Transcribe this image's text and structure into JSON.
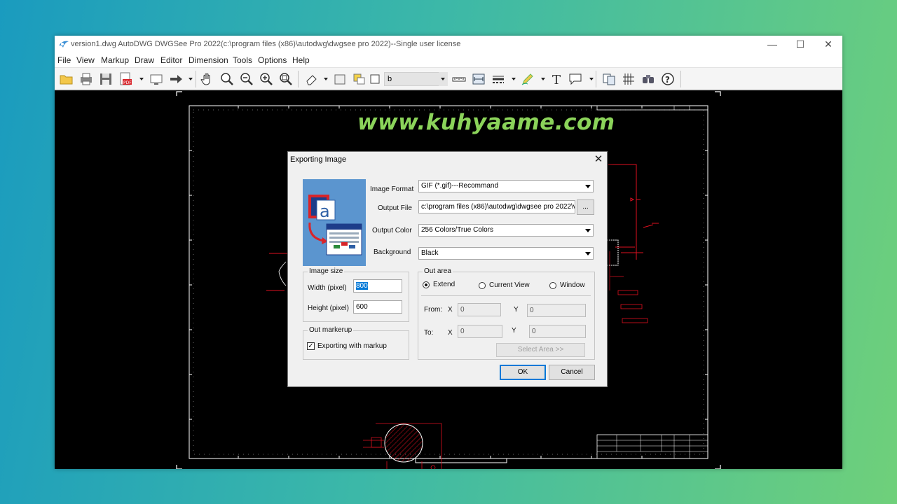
{
  "window": {
    "title": "version1.dwg AutoDWG DWGSee Pro 2022(c:\\program files (x86)\\autodwg\\dwgsee pro 2022)--Single user license",
    "minimize_glyph": "—",
    "maximize_glyph": "☐",
    "close_glyph": "✕"
  },
  "menu": [
    "File",
    "View",
    "Markup",
    "Draw",
    "Editor",
    "Dimension",
    "Tools",
    "Options",
    "Help"
  ],
  "toolbar": {
    "layer_value": "b",
    "icons": [
      "open-folder-icon",
      "print-icon",
      "save-icon",
      "export-pdf-icon",
      "screen-icon",
      "arrow-right-icon",
      "pan-hand-icon",
      "zoom-window-icon",
      "zoom-out-icon",
      "zoom-in-icon",
      "zoom-extents-icon",
      "eraser-icon",
      "layer-rect-icon",
      "layer-color-icon",
      "layer-square-icon",
      "measure-icon",
      "dimension-icon",
      "linetype-icon",
      "pen-icon",
      "text-icon",
      "comment-icon",
      "compare-icon",
      "hatch-icon",
      "find-icon",
      "help-icon"
    ]
  },
  "watermark": "www.kuhyaame.com",
  "dialog": {
    "title": "Exporting Image",
    "close_glyph": "✕",
    "image_format_label": "Image Format",
    "image_format_value": "GIF (*.gif)---Recommand",
    "output_file_label": "Output File",
    "output_file_value": "c:\\program files (x86)\\autodwg\\dwgsee pro 2022\\v",
    "browse_label": "...",
    "output_color_label": "Output Color",
    "output_color_value": "256 Colors/True Colors",
    "background_label": "Background",
    "background_value": "Black",
    "image_size": {
      "title": "Image size",
      "width_label": "Width (pixel)",
      "width_value": "800",
      "height_label": "Height (pixel)",
      "height_value": "600"
    },
    "out_markerup": {
      "title": "Out markerup",
      "checkbox_label": "Exporting with markup",
      "checked": true
    },
    "out_area": {
      "title": "Out area",
      "options": [
        "Extend",
        "Current View",
        "Window"
      ],
      "selected": "Extend",
      "from_label": "From:",
      "to_label": "To:",
      "x_label": "X",
      "y_label": "Y",
      "from_x": "0",
      "from_y": "0",
      "to_x": "0",
      "to_y": "0",
      "select_area_label": "Select  Area  >>"
    },
    "ok_label": "OK",
    "cancel_label": "Cancel"
  },
  "colors": {
    "canvas": "#000000",
    "drawing_red": "#e01020",
    "watermark": "#8bd35a",
    "accent": "#0078d7"
  }
}
